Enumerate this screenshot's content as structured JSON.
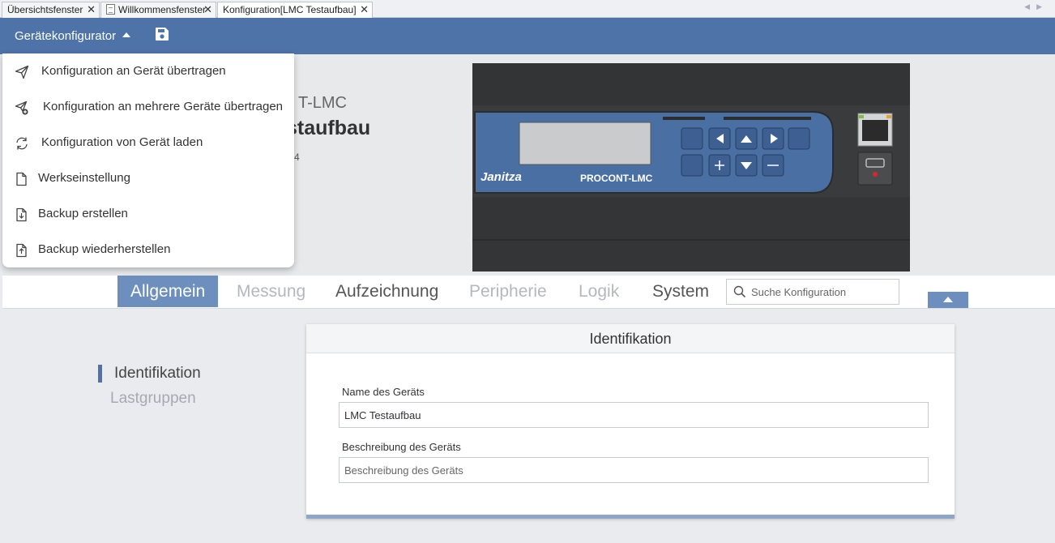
{
  "doc_tabs": [
    {
      "label": "Übersichtsfenster",
      "close": "✕"
    },
    {
      "label": "Willkommensfenster",
      "close": "✕"
    },
    {
      "label": "Konfiguration[LMC Testaufbau]",
      "close": "✕"
    }
  ],
  "toolbar": {
    "configurator_label": "Gerätekonfigurator",
    "save_icon": "floppy-disk-icon"
  },
  "menu": {
    "items": [
      {
        "label": "Konfiguration an Gerät übertragen",
        "icon": "send-icon"
      },
      {
        "label": "Konfiguration an mehrere Geräte übertragen",
        "icon": "send-multiple-icon"
      },
      {
        "label": "Konfiguration von Gerät laden",
        "icon": "refresh-icon"
      },
      {
        "label": "Werkseinstellung",
        "icon": "document-icon"
      },
      {
        "label": "Backup erstellen",
        "icon": "file-download-icon"
      },
      {
        "label": "Backup wiederherstellen",
        "icon": "file-upload-icon"
      }
    ]
  },
  "device": {
    "type_partial": "T-LMC",
    "name_partial": "staufbau",
    "number_partial": "4",
    "image_brand": "Janitza",
    "image_model": "PROCONT-LMC"
  },
  "nav_tabs": [
    {
      "label": "Allgemein"
    },
    {
      "label": "Messung"
    },
    {
      "label": "Aufzeichnung"
    },
    {
      "label": "Peripherie"
    },
    {
      "label": "Logik"
    },
    {
      "label": "System"
    }
  ],
  "search": {
    "placeholder": "Suche Konfiguration"
  },
  "side_nav": [
    {
      "label": "Identifikation"
    },
    {
      "label": "Lastgruppen"
    }
  ],
  "card": {
    "title": "Identifikation",
    "fields": [
      {
        "label": "Name des Geräts",
        "value": "LMC Testaufbau",
        "placeholder": ""
      },
      {
        "label": "Beschreibung des Geräts",
        "value": "",
        "placeholder": "Beschreibung des Geräts"
      }
    ]
  },
  "colors": {
    "toolbar_blue": "#4e73a8",
    "active_tab": "#6d8fbd"
  }
}
